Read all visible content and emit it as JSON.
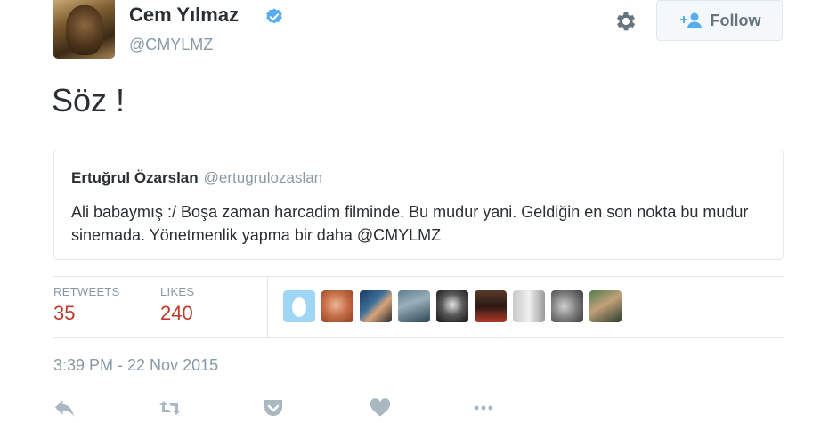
{
  "author": {
    "name": "Cem Yılmaz",
    "handle": "@CMYLMZ",
    "verified": true
  },
  "header": {
    "follow_label": "Follow"
  },
  "tweet": {
    "text": "Söz !"
  },
  "quote": {
    "name": "Ertuğrul Özarslan",
    "handle": "@ertugrulozaslan",
    "text": "Ali babaymış :/ Boşa zaman harcadim filminde. Bu mudur yani. Geldiğin en son nokta bu mudur sinemada. Yönetmenlik yapma bir daha @CMYLMZ"
  },
  "stats": {
    "retweets_label": "RETWEETS",
    "retweets_count": "35",
    "likes_label": "LIKES",
    "likes_count": "240"
  },
  "likers": [
    {
      "icon": "default-egg-avatar"
    },
    {
      "icon": "avatar"
    },
    {
      "icon": "avatar"
    },
    {
      "icon": "avatar"
    },
    {
      "icon": "avatar"
    },
    {
      "icon": "avatar"
    },
    {
      "icon": "avatar"
    },
    {
      "icon": "avatar"
    },
    {
      "icon": "avatar"
    }
  ],
  "timestamp": "3:39 PM - 22 Nov 2015",
  "actions": [
    "reply-icon",
    "retweet-icon",
    "pocket-icon",
    "like-icon",
    "more-icon"
  ],
  "colors": {
    "accent": "#55acee",
    "count_red": "#c0392b",
    "muted": "#8899a6"
  }
}
